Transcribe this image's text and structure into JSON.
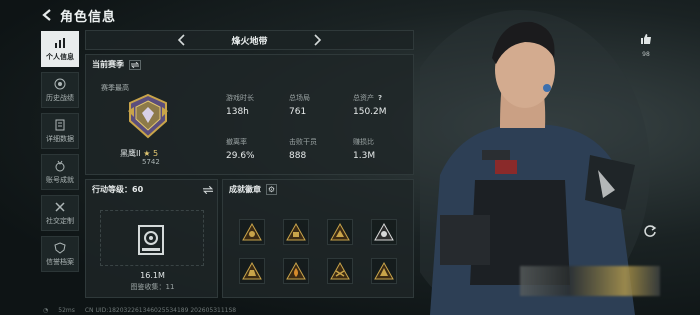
{
  "header": {
    "title": "角色信息"
  },
  "sidebar": {
    "items": [
      {
        "label": "个人信息",
        "icon": "bar-chart-icon",
        "active": true
      },
      {
        "label": "历史战绩",
        "icon": "target-icon",
        "active": false
      },
      {
        "label": "详细数据",
        "icon": "document-icon",
        "active": false
      },
      {
        "label": "账号成就",
        "icon": "medal-icon",
        "active": false
      },
      {
        "label": "社交定制",
        "icon": "tools-icon",
        "active": false
      },
      {
        "label": "信誉档案",
        "icon": "shield-icon",
        "active": false
      }
    ]
  },
  "season_nav": {
    "name": "烽火地带"
  },
  "current_season": {
    "heading": "当前赛季",
    "best_label": "赛季最高",
    "rank_name": "黑鹰II",
    "rank_stars": "★ 5",
    "rank_score": "5742",
    "stats": [
      {
        "label": "游戏时长",
        "value": "138h"
      },
      {
        "label": "总场局",
        "value": "761"
      },
      {
        "label": "总资产",
        "value": "150.2M",
        "help": "?"
      },
      {
        "label": "撤离率",
        "value": "29.6%"
      },
      {
        "label": "击败干员",
        "value": "888"
      },
      {
        "label": "赚损比",
        "value": "1.3M"
      }
    ]
  },
  "action_level": {
    "heading": "行动等级：60",
    "reserve_value": "16.1M",
    "reserve_sub": "图鉴收集：11"
  },
  "achievements": {
    "heading": "成就徽章",
    "badges": [
      "helmet-badge",
      "shield-badge",
      "skull-badge",
      "gear-badge",
      "wolf-badge",
      "flame-badge",
      "hunter-badge",
      "pyramid-badge"
    ]
  },
  "profile": {
    "like_count": "98"
  },
  "footer": {
    "ping": "52ms",
    "uid": "CN UID:182032261346025534189 2026053111S8"
  },
  "colors": {
    "accent": "#e8ecec",
    "panel": "#1e2627",
    "gold": "#c9a44a"
  }
}
